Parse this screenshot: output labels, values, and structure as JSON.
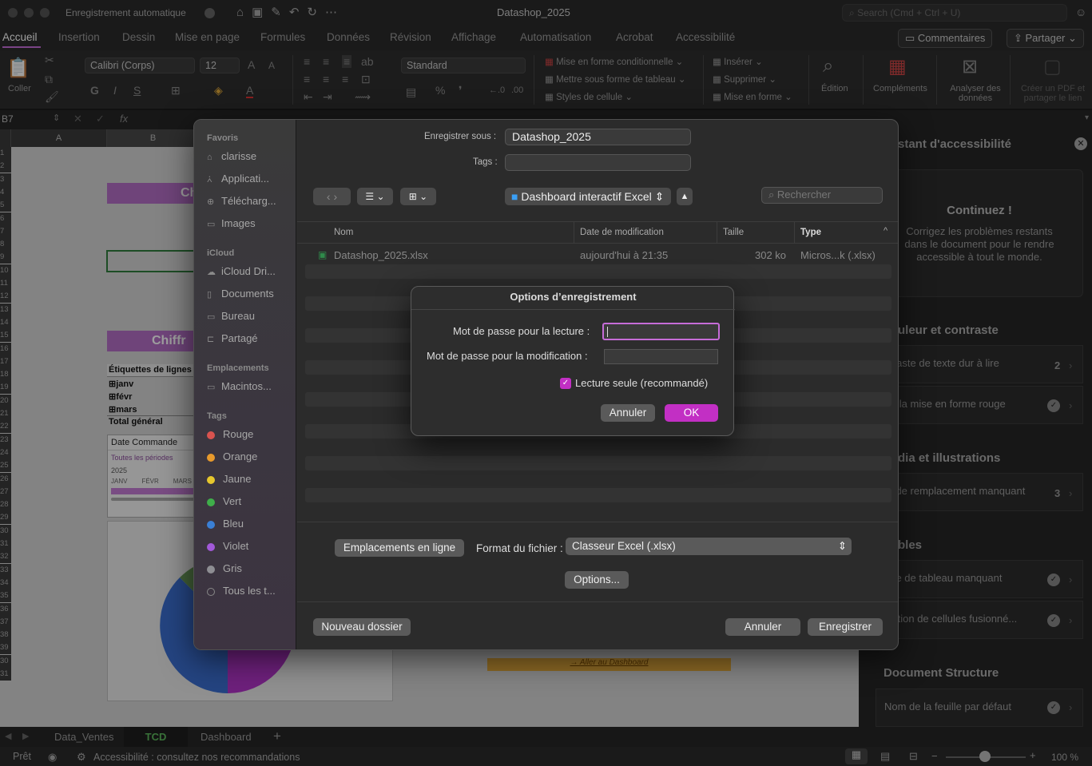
{
  "titlebar": {
    "autosave": "Enregistrement automatique",
    "doc_title": "Datashop_2025",
    "search_placeholder": "Search (Cmd + Ctrl + U)"
  },
  "ribbon_tabs": [
    "Accueil",
    "Insertion",
    "Dessin",
    "Mise en page",
    "Formules",
    "Données",
    "Révision",
    "Affichage",
    "Automatisation",
    "Acrobat",
    "Accessibilité"
  ],
  "ribbon_buttons": {
    "comments": "Commentaires",
    "share": "Partager"
  },
  "ribbon": {
    "paste": "Coller",
    "font": "Calibri (Corps)",
    "font_size": "12",
    "number_format": "Standard",
    "cond_format": "Mise en forme conditionnelle",
    "table_format": "Mettre sous forme de tableau",
    "cell_styles": "Styles de cellule",
    "insert": "Insérer",
    "delete": "Supprimer",
    "format": "Mise en forme",
    "edit": "Édition",
    "addins": "Compléments",
    "analyze": "Analyser des données",
    "pdf": "Créer un PDF et partager le lien"
  },
  "formula_bar": {
    "cell": "B7",
    "fx": "fx"
  },
  "sheet": {
    "cols": [
      "A",
      "B"
    ],
    "rows": [
      "1",
      "2",
      "3",
      "4",
      "5",
      "6",
      "7",
      "8",
      "9",
      "10",
      "11",
      "12",
      "13",
      "14",
      "15",
      "16",
      "17",
      "18",
      "19",
      "20",
      "21",
      "22",
      "23",
      "24",
      "25",
      "26",
      "27",
      "28",
      "29",
      "30",
      "31",
      "32",
      "33",
      "34",
      "35",
      "36",
      "37",
      "38",
      "39",
      "30",
      "31"
    ],
    "title1": "Ch",
    "title2": "Chiffr",
    "pivot_header": "Étiquettes de lignes",
    "pivot_rows": [
      "janv",
      "févr",
      "mars"
    ],
    "pivot_total": "Total général",
    "slicer_title": "Date Commande",
    "slicer_sub": "Toutes les périodes",
    "slicer_year": "2025",
    "slicer_months": [
      "JANV",
      "FÉVR",
      "MARS"
    ],
    "link": "→ Aller au Dashboard"
  },
  "accessibility_panel": {
    "title": "stant d'accessibilité",
    "card_title": "Continuez !",
    "card_text": "Corrigez les problèmes restants dans le document pour le rendre accessible à tout le monde.",
    "sec1": "uleur et contraste",
    "item1": "ntraste de texte dur à lire",
    "item1_count": "2",
    "item2": "ter la mise en forme rouge",
    "sec2": "dia et illustrations",
    "item3": "te de remplacement manquant",
    "item3_count": "3",
    "sec3": "bles",
    "item4": "tête de tableau manquant",
    "item5": "isation de cellules fusionné...",
    "sec4": "Document Structure",
    "item6": "Nom de la feuille par défaut"
  },
  "sheet_tabs": [
    "Data_Ventes",
    "TCD",
    "Dashboard"
  ],
  "statusbar": {
    "ready": "Prêt",
    "accessibility": "Accessibilité : consultez nos recommandations",
    "zoom": "100 %"
  },
  "save_dialog": {
    "sidebar": {
      "favorites_h": "Favoris",
      "favorites": [
        "clarisse",
        "Applicati...",
        "Télécharg...",
        "Images"
      ],
      "icloud_h": "iCloud",
      "icloud": [
        "iCloud Dri...",
        "Documents",
        "Bureau",
        "Partagé"
      ],
      "places_h": "Emplacements",
      "places": [
        "Macintos..."
      ],
      "tags_h": "Tags",
      "tags": [
        {
          "name": "Rouge",
          "color": "#d9534f"
        },
        {
          "name": "Orange",
          "color": "#e89a2c"
        },
        {
          "name": "Jaune",
          "color": "#e6c72d"
        },
        {
          "name": "Vert",
          "color": "#3fae4a"
        },
        {
          "name": "Bleu",
          "color": "#3a7fd5"
        },
        {
          "name": "Violet",
          "color": "#a259d9"
        },
        {
          "name": "Gris",
          "color": "#8e8e93"
        },
        {
          "name": "Tous les t...",
          "color": ""
        }
      ]
    },
    "save_as_label": "Enregistrer sous :",
    "save_as_value": "Datashop_2025",
    "tags_label": "Tags :",
    "location": "Dashboard interactif Excel",
    "search_placeholder": "Rechercher",
    "columns": {
      "name": "Nom",
      "date": "Date de modification",
      "size": "Taille",
      "type": "Type"
    },
    "files": [
      {
        "name": "Datashop_2025.xlsx",
        "date": "aujourd'hui à 21:35",
        "size": "302 ko",
        "type": "Micros...k (.xlsx)"
      }
    ],
    "online_locations": "Emplacements en ligne",
    "format_label": "Format du fichier :",
    "format_value": "Classeur Excel (.xlsx)",
    "options_btn": "Options...",
    "new_folder": "Nouveau dossier",
    "cancel": "Annuler",
    "save": "Enregistrer"
  },
  "options_dialog": {
    "title": "Options d’enregistrement",
    "read_pw_label": "Mot de passe pour la lecture :",
    "read_pw_value": "",
    "modify_pw_label": "Mot de passe pour la modification :",
    "modify_pw_value": "",
    "readonly_label": "Lecture seule (recommandé)",
    "readonly_checked": true,
    "cancel": "Annuler",
    "ok": "OK"
  },
  "colors": {
    "accent": "#c22fc4",
    "pivot_header": "#b36ec6",
    "link_bar": "#e0a83a"
  }
}
